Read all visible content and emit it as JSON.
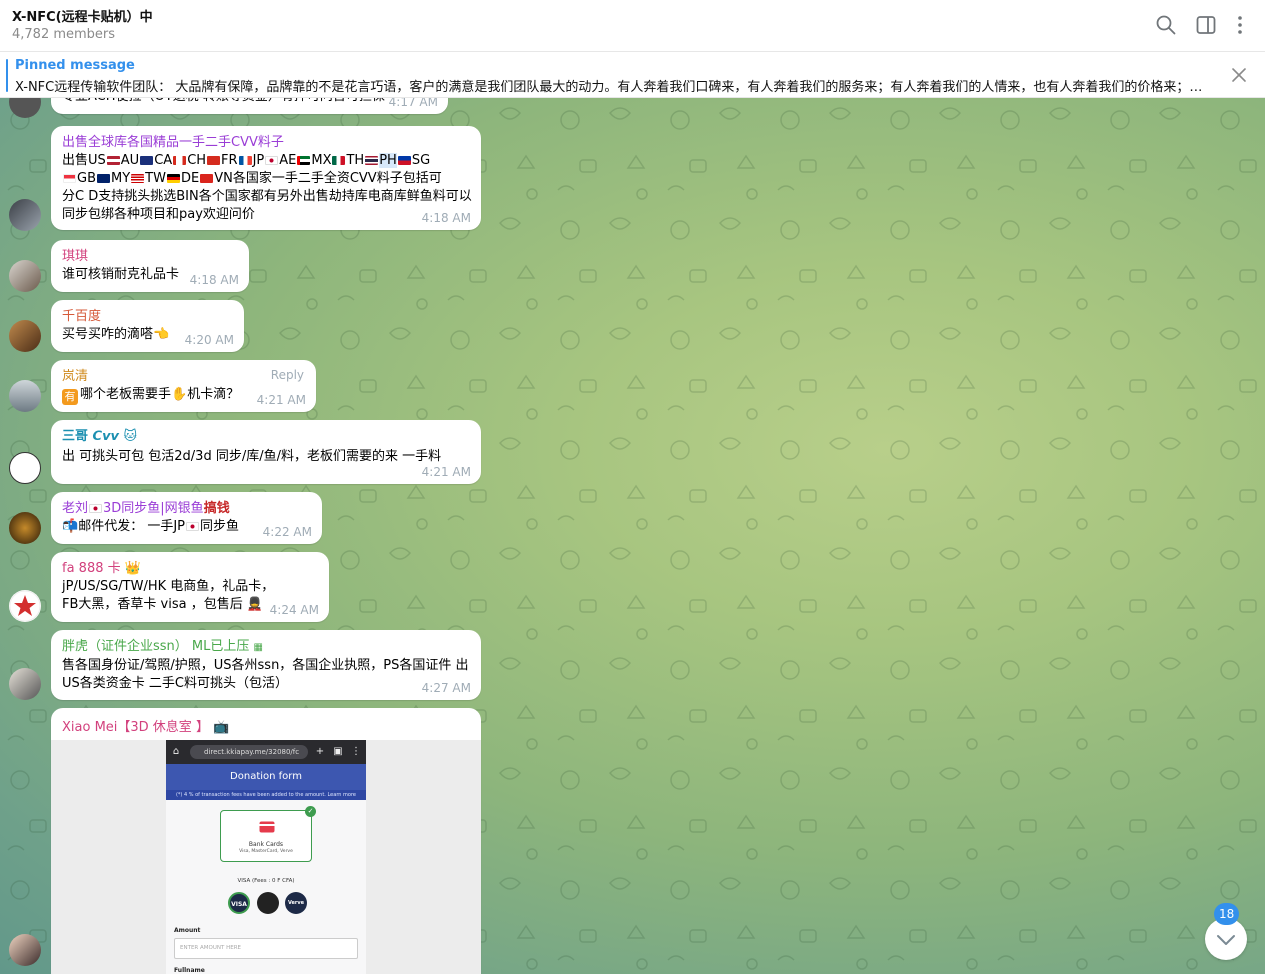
{
  "header": {
    "title": "X-NFC(远程卡贴机）中",
    "members": "4,782 members",
    "icons": [
      "search-icon",
      "sidebar-toggle-icon",
      "more-vertical-icon"
    ]
  },
  "pinned": {
    "title": "Pinned message",
    "text": "X-NFC远程传输软件团队： 大品牌有保障，品牌靠的不是花言巧语，客户的满意是我们团队最大的动力。有人奔着我们口碑来，有人奔着我们的服务来；有人奔着我们的人情来，也有人奔着我们的价格来；…"
  },
  "messages": [
    {
      "id": "m0",
      "text": "专业ACH梗拉（OT退税 转账等资金）有押可问否可担保",
      "time": "4:17 AM"
    },
    {
      "id": "m1",
      "name": "出售全球库各国精品一手二手CVV料子",
      "name_color": "#9a3dd6",
      "line1_segments": [
        "出售US",
        "AU",
        "CA",
        "CH",
        "FR",
        "JP",
        "AE",
        "MX",
        "TH",
        "PH",
        "SG"
      ],
      "line2_segments": [
        "GB",
        "MY",
        "TW",
        "DE",
        "VN",
        "各国家一手二手全资CVV料子包括可"
      ],
      "line3": "分C D支持挑头挑选BIN各个国家都有另外出售劫持库电商库鲜鱼料可以",
      "line4": "同步包绑各种项目和pay欢迎问价",
      "time": "4:18 AM"
    },
    {
      "id": "m2",
      "name": "琪琪",
      "name_color": "#d2417d",
      "text": "谁可核销耐克礼品卡",
      "time": "4:18 AM"
    },
    {
      "id": "m3",
      "name": "千百度",
      "name_color": "#d55a3a",
      "text": "买号买咋的滴嗒",
      "time": "4:20 AM"
    },
    {
      "id": "m4",
      "name": "岚清",
      "name_color": "#d08a1c",
      "text_pre": "有",
      "text": "哪个老板需要手",
      "text_post": "机卡滴？",
      "reply": "Reply",
      "time": "4:21 AM"
    },
    {
      "id": "m5",
      "name": "三哥 𝘾𝙫𝙫",
      "name_color": "#1b8fb0",
      "text": "出 可挑头可包 包活2d/3d 同步/库/鱼/料，老板们需要的来 一手料",
      "time": "4:21 AM"
    },
    {
      "id": "m6",
      "name_pre": "老刘",
      "name": "3D同步鱼|网银鱼",
      "name_post": "搞钱",
      "name_color": "#9a3dd6",
      "text": "邮件代发： 一手JP",
      "text_post": "同步鱼",
      "time": "4:22 AM"
    },
    {
      "id": "m7",
      "name": "fa 888 卡",
      "name_color": "#d2417d",
      "line1": "jP/US/SG/TW/HK 电商鱼，礼品卡，",
      "line2": "FB大黑，香草卡 visa ，包售后",
      "time": "4:24 AM"
    },
    {
      "id": "m8",
      "name": "胖虎（证件企业ssn） ML已上压",
      "name_color": "#4aa84b",
      "line1": "售各国身份证/驾照/护照，US各州ssn，各国企业执照，PS各国证件  出",
      "line2": "US各类资金卡  二手C料可挑头（包活）",
      "time": "4:27 AM"
    },
    {
      "id": "m9",
      "name": "Xiao Mei【3D 休息室 】",
      "name_color": "#d2417d",
      "screenshot": {
        "url": "direct.kkiapay.me/32080/fc",
        "form_title": "Donation form",
        "fee_note": "(*) 4 % of transaction fees have been added to the amount.  Learn more",
        "card_title": "Bank Cards",
        "card_sub": "Visa, MasterCard, Verve",
        "visa_label": "VISA  (Fees : 0 F CFA)",
        "methods": [
          "VISA",
          "MC",
          "Verve"
        ],
        "amount_label": "Amount",
        "amount_placeholder": "ENTER AMOUNT HERE",
        "fullname_label": "Fullname"
      }
    }
  ],
  "unread_count": "18",
  "colors": {
    "accent": "#3390ec",
    "time": "#a0acb6"
  }
}
